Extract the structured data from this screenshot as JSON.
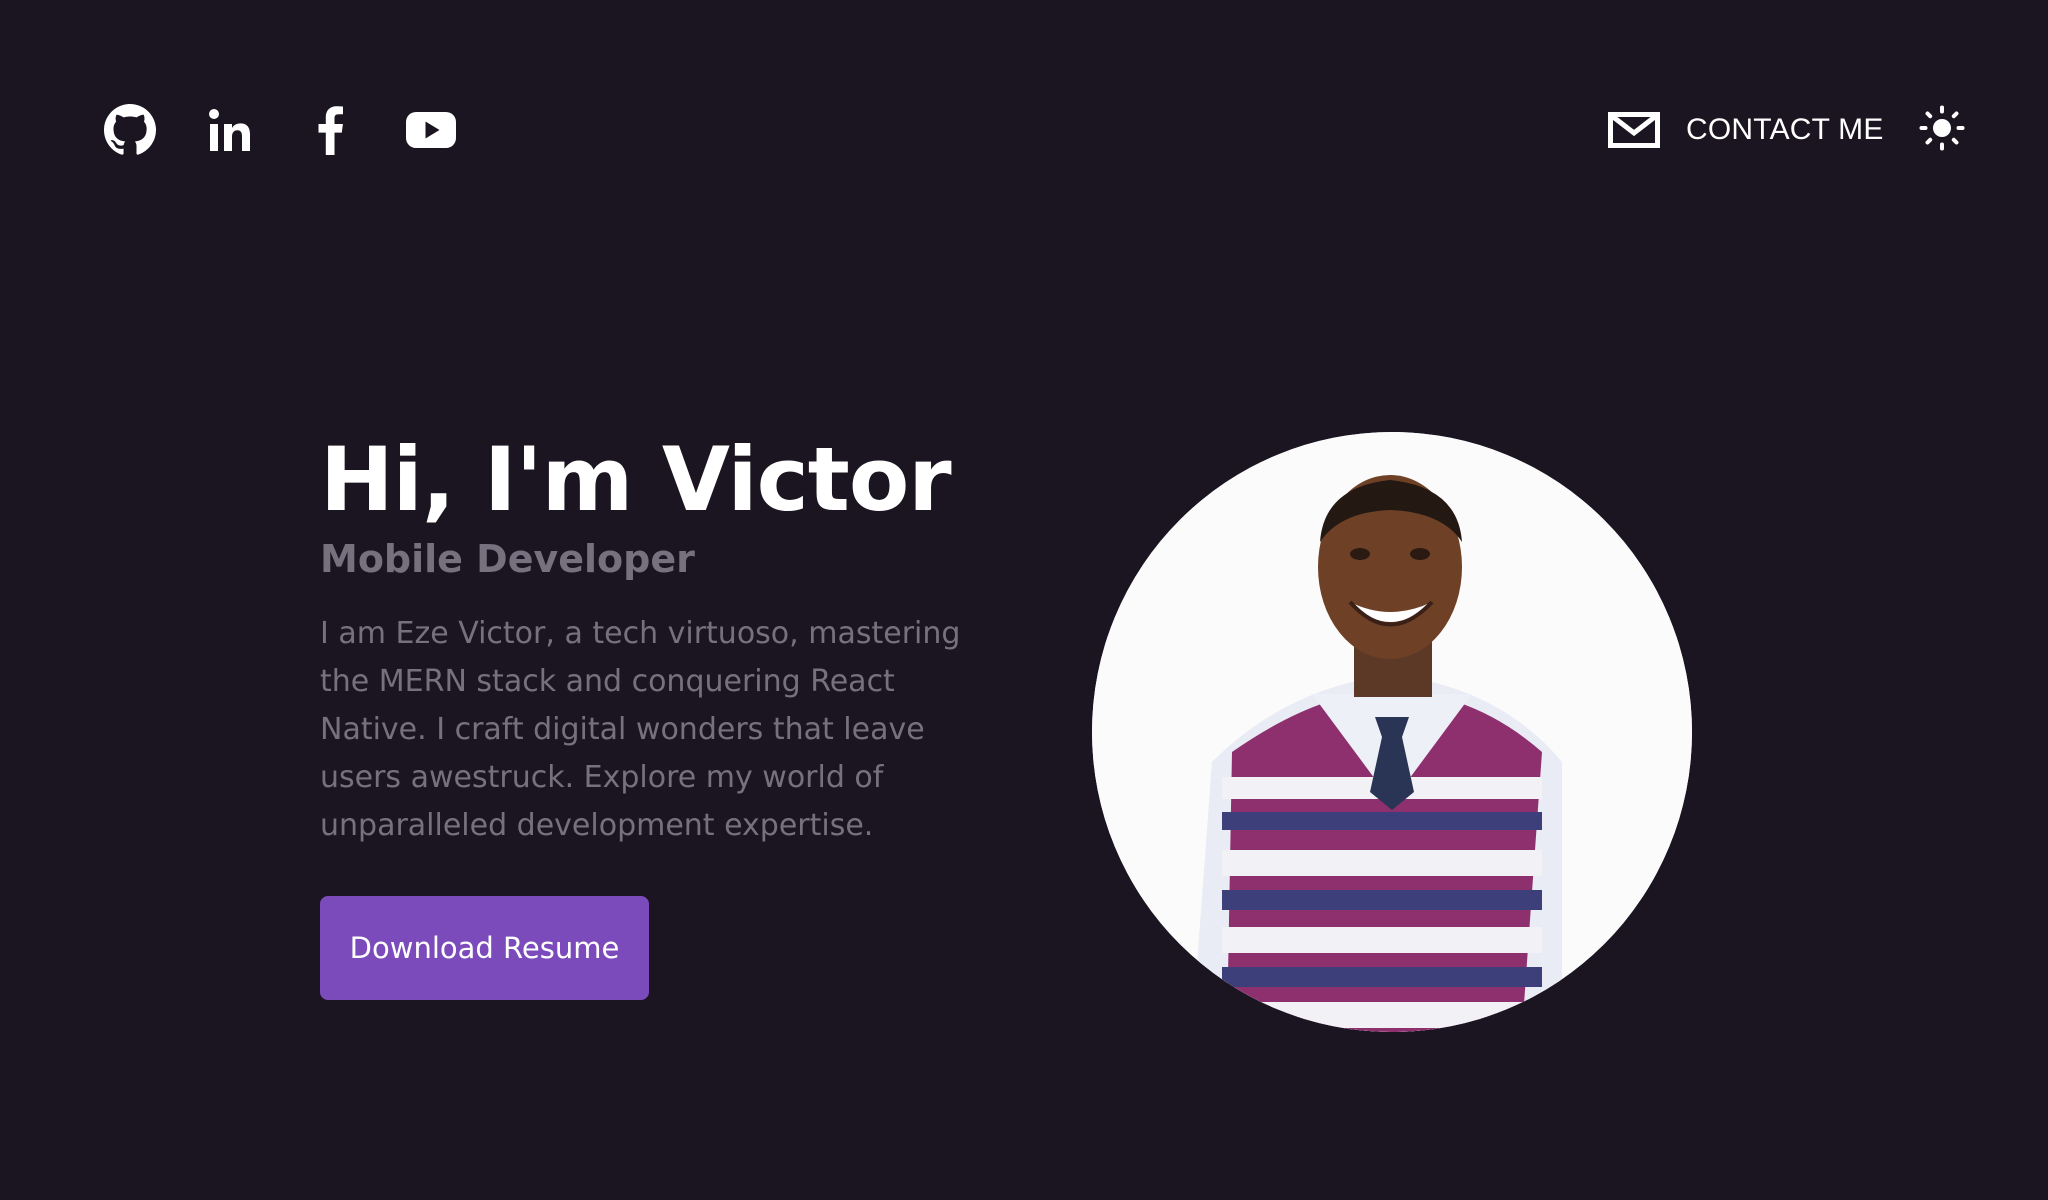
{
  "header": {
    "social_links": [
      {
        "name": "GitHub",
        "icon": "github-icon"
      },
      {
        "name": "LinkedIn",
        "icon": "linkedin-icon"
      },
      {
        "name": "Facebook",
        "icon": "facebook-icon"
      },
      {
        "name": "YouTube",
        "icon": "youtube-icon"
      }
    ],
    "contact_label": "CONTACT ME",
    "contact_icon": "mail-icon",
    "theme_icon": "sun-icon"
  },
  "hero": {
    "title": "Hi, I'm Victor",
    "role": "Mobile Developer",
    "description": "I am Eze Victor, a tech virtuoso, mastering the MERN stack and conquering React Native. I craft digital wonders that leave users awestruck. Explore my world of unparalleled development expertise.",
    "button_label": "Download Resume"
  },
  "colors": {
    "background": "#1b1521",
    "accent": "#7b4bbb",
    "muted_text": "#77717f",
    "text": "#ffffff"
  }
}
